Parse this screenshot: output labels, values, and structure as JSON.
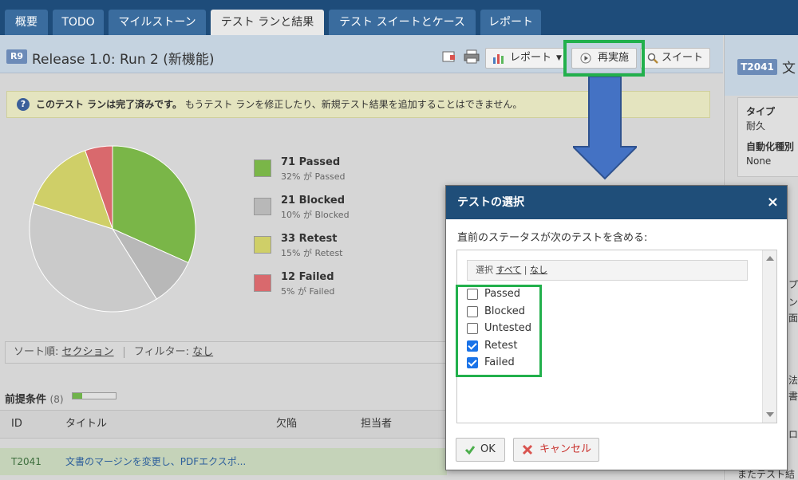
{
  "tabs": [
    {
      "label": "概要",
      "active": false
    },
    {
      "label": "TODO",
      "active": false
    },
    {
      "label": "マイルストーン",
      "active": false
    },
    {
      "label": "テスト ランと結果",
      "active": true
    },
    {
      "label": "テスト スイートとケース",
      "active": false
    },
    {
      "label": "レポート",
      "active": false
    }
  ],
  "run": {
    "badge": "R9",
    "title": "Release 1.0: Run 2 (新機能)"
  },
  "toolbar": {
    "report_label": "レポート",
    "rerun_label": "再実施",
    "suite_label": "スイート"
  },
  "notice": {
    "bold": "このテスト ランは完了済みです。",
    "text": "もうテスト ランを修正したり、新規テスト結果を追加することはできません。"
  },
  "stats": [
    {
      "title": "71 Passed",
      "sub": "32% が Passed",
      "color": "#7ab648"
    },
    {
      "title": "21 Blocked",
      "sub": "10% が Blocked",
      "color": "#b8b8b8"
    },
    {
      "title": "33 Retest",
      "sub": "15% が Retest",
      "color": "#cfcf68"
    },
    {
      "title": "12 Failed",
      "sub": "5% が Failed",
      "color": "#d9696d"
    }
  ],
  "chart_data": {
    "type": "pie",
    "values": [
      71,
      21,
      87,
      33,
      12
    ],
    "colors": [
      "#7ab648",
      "#b8b8b8",
      "#cacaca",
      "#cfcf68",
      "#d9696d"
    ]
  },
  "sortbar": {
    "sort_label": "ソート順:",
    "sort_value": "セクション",
    "filter_label": "フィルター:",
    "filter_value": "なし"
  },
  "section": {
    "title": "前提条件",
    "count": "(8)",
    "progress": 0.22
  },
  "table": {
    "headers": {
      "id": "ID",
      "title": "タイトル",
      "defects": "欠陥",
      "assignee": "担当者"
    },
    "rows": [
      {
        "id": "T2041",
        "title": "文書のマージンを変更し、PDFエクスポ..."
      }
    ]
  },
  "right_panel": {
    "badge": "T2041",
    "title_fragment": "文",
    "type_label": "タイプ",
    "type_value": "耐久",
    "auto_label": "自動化種別",
    "auto_value": "None",
    "fragments": [
      "プロ",
      "ン",
      "面",
      "法",
      "書",
      "ロ",
      "またテスト結"
    ]
  },
  "dialog": {
    "title": "テストの選択",
    "close": "×",
    "prompt": "直前のステータスが次のテストを含める:",
    "select_label": "選択",
    "select_all": "すべて",
    "select_sep": "|",
    "select_none": "なし",
    "options": [
      {
        "label": "Passed",
        "checked": false
      },
      {
        "label": "Blocked",
        "checked": false
      },
      {
        "label": "Untested",
        "checked": false
      },
      {
        "label": "Retest",
        "checked": true
      },
      {
        "label": "Failed",
        "checked": true
      }
    ],
    "ok_label": "OK",
    "cancel_label": "キャンセル"
  }
}
